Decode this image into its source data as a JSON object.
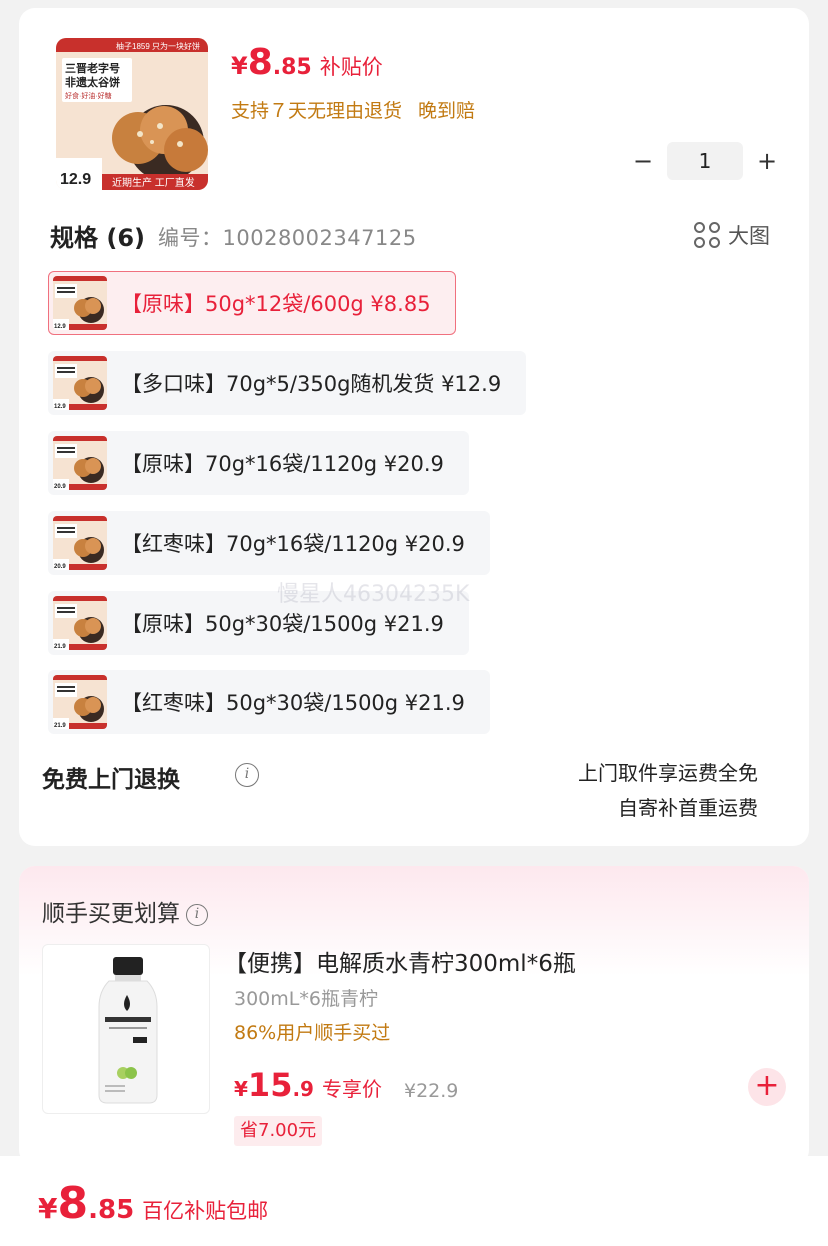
{
  "product": {
    "price_currency": "¥",
    "price_int": "8",
    "price_dec": ".85",
    "price_tag": "补贴价",
    "service": [
      "支持７天无理由退货",
      "晚到赔"
    ],
    "image": {
      "brand": "柚子1859 只为一块好饼",
      "title_line1": "三晋老字号",
      "title_line2": "非遗太谷饼",
      "features": "好食·好油·好糖",
      "price_badge": "12.9",
      "footer": "近期生产 工厂直发"
    }
  },
  "quantity": {
    "minus_label": "−",
    "value": "1",
    "plus_label": "+"
  },
  "spec": {
    "title": "规格 (6)",
    "code_label": "编号：",
    "code": "10028002347125",
    "bigpic_label": "大图",
    "options": [
      {
        "label": "【原味】50g*12袋/600g  ¥8.85",
        "selected": true,
        "badge": "12.9"
      },
      {
        "label": "【多口味】70g*5/350g随机发货  ¥12.9",
        "selected": false,
        "badge": "12.9"
      },
      {
        "label": "【原味】70g*16袋/1120g  ¥20.9",
        "selected": false,
        "badge": "20.9"
      },
      {
        "label": "【红枣味】70g*16袋/1120g  ¥20.9",
        "selected": false,
        "badge": "20.9"
      },
      {
        "label": "【原味】50g*30袋/1500g  ¥21.9",
        "selected": false,
        "badge": "21.9"
      },
      {
        "label": "【红枣味】50g*30袋/1500g  ¥21.9",
        "selected": false,
        "badge": "21.9"
      }
    ]
  },
  "return_service": {
    "title": "免费上门退换",
    "line1": "上门取件享运费全免",
    "line2": "自寄补首重运费"
  },
  "watermark": "慢星人46304235K",
  "addon": {
    "title": "顺手买更划算",
    "name": "【便携】电解质水青柠300ml*6瓶",
    "sub": "300mL*6瓶青柠",
    "popularity": "86%用户顺手买过",
    "price_currency": "¥",
    "price_int": "15",
    "price_dec": ".9",
    "price_tag": "专享价",
    "orig_price": "¥22.9",
    "save": "省7.00元",
    "add_label": "+"
  },
  "bottom_bar": {
    "price_currency": "¥",
    "price_int": "8",
    "price_dec": ".85",
    "tag": "百亿补贴包邮"
  },
  "colors": {
    "accent": "#e8213a",
    "service": "#c27a12",
    "selected_bg": "#fdeef0"
  }
}
